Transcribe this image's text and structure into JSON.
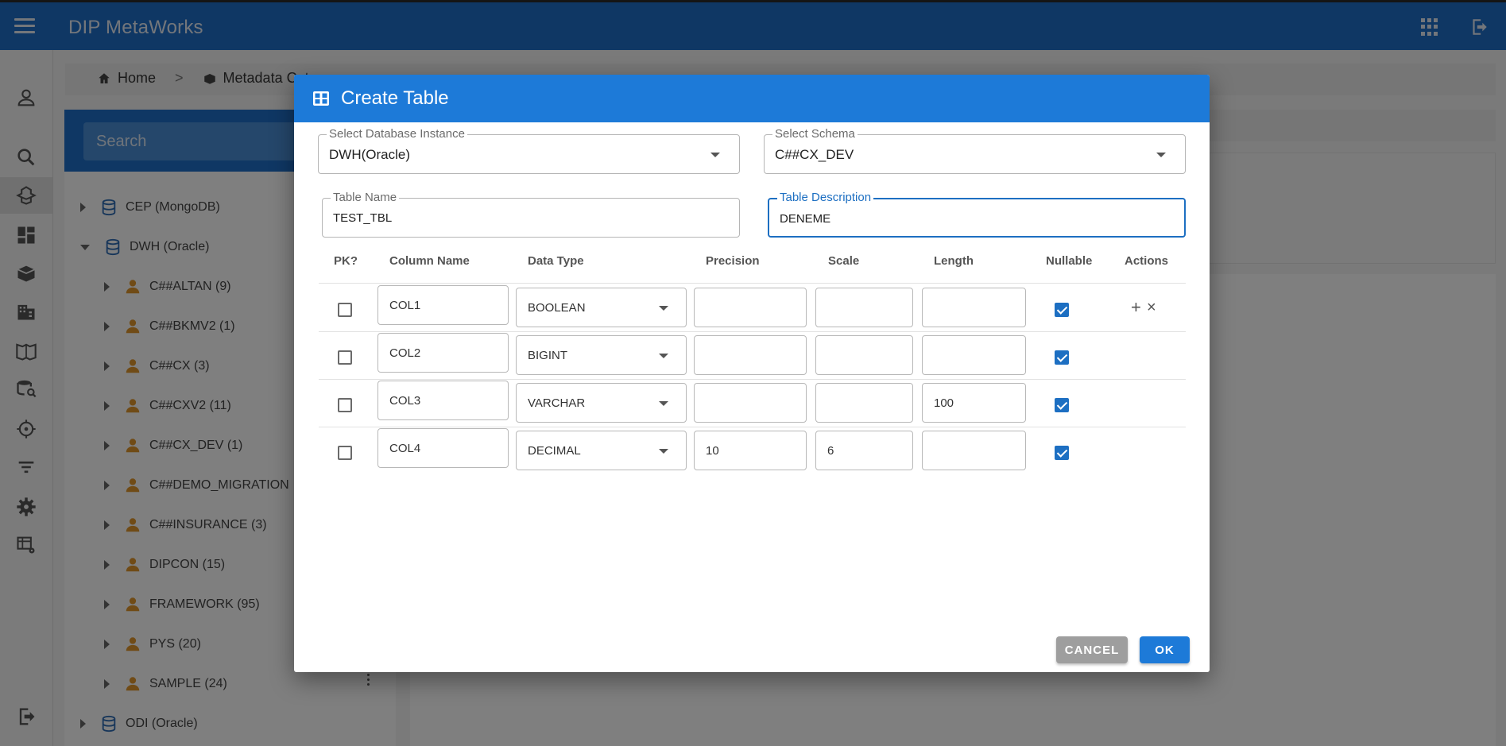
{
  "app": {
    "title": "DIP MetaWorks"
  },
  "breadcrumb": {
    "home": "Home",
    "separator": ">",
    "current": "Metadata Cata"
  },
  "search": {
    "placeholder": "Search"
  },
  "tree": {
    "nodes": [
      {
        "label": "CEP (MongoDB)",
        "type": "database",
        "expanded": false
      },
      {
        "label": "DWH (Oracle)",
        "type": "database",
        "expanded": true
      },
      {
        "label": "C##ALTAN (9)",
        "type": "schema"
      },
      {
        "label": "C##BKMV2 (1)",
        "type": "schema"
      },
      {
        "label": "C##CX (3)",
        "type": "schema"
      },
      {
        "label": "C##CXV2 (11)",
        "type": "schema"
      },
      {
        "label": "C##CX_DEV (1)",
        "type": "schema"
      },
      {
        "label": "C##DEMO_MIGRATION",
        "type": "schema"
      },
      {
        "label": "C##INSURANCE (3)",
        "type": "schema"
      },
      {
        "label": "DIPCON (15)",
        "type": "schema"
      },
      {
        "label": "FRAMEWORK (95)",
        "type": "schema"
      },
      {
        "label": "PYS (20)",
        "type": "schema"
      },
      {
        "label": "SAMPLE (24)",
        "type": "schema"
      },
      {
        "label": "ODI (Oracle)",
        "type": "database",
        "expanded": false
      }
    ]
  },
  "dialog": {
    "title": "Create Table",
    "db_instance": {
      "label": "Select Database Instance",
      "value": "DWH(Oracle)"
    },
    "schema": {
      "label": "Select Schema",
      "value": "C##CX_DEV"
    },
    "table_name": {
      "label": "Table Name",
      "value": "TEST_TBL"
    },
    "table_description": {
      "label": "Table Description",
      "value": "DENEME"
    },
    "columns_header": [
      "PK?",
      "Column Name",
      "Data Type",
      "Precision",
      "Scale",
      "Length",
      "Nullable",
      "Actions"
    ],
    "rows": [
      {
        "pk": false,
        "name": "COL1",
        "type": "BOOLEAN",
        "precision": "",
        "scale": "",
        "length": "",
        "nullable": true
      },
      {
        "pk": false,
        "name": "COL2",
        "type": "BIGINT",
        "precision": "",
        "scale": "",
        "length": "",
        "nullable": true
      },
      {
        "pk": false,
        "name": "COL3",
        "type": "VARCHAR",
        "precision": "",
        "scale": "",
        "length": "100",
        "nullable": true
      },
      {
        "pk": false,
        "name": "COL4",
        "type": "DECIMAL",
        "precision": "10",
        "scale": "6",
        "length": "",
        "nullable": true
      }
    ],
    "actions": {
      "add": "+",
      "remove": "×"
    },
    "cancel_label": "CANCEL",
    "ok_label": "OK"
  },
  "colors": {
    "primary": "#1e6fc9",
    "dialog_header": "#1d7ad8",
    "schema_icon": "#e0962c",
    "db_icon": "#2f6db5"
  }
}
